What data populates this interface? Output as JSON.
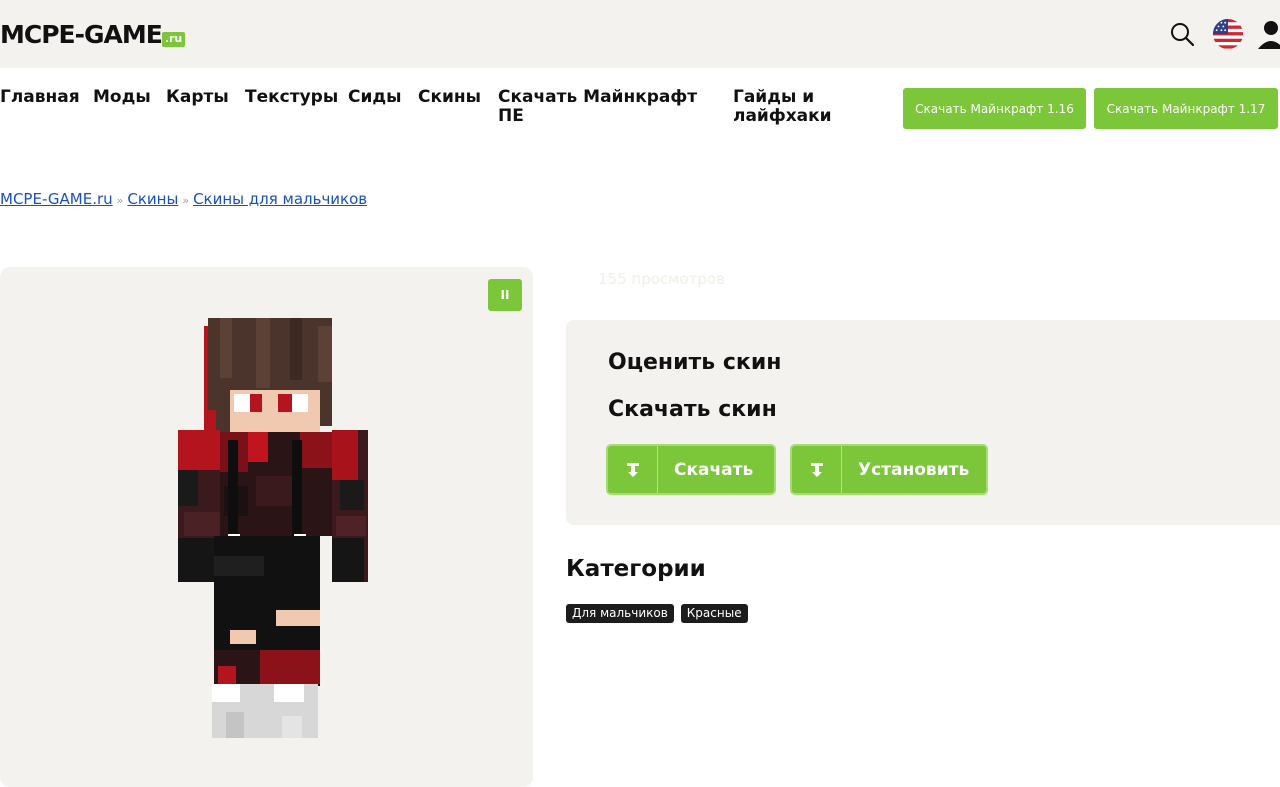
{
  "header": {
    "logo_text": "MCPE-GAME",
    "logo_suffix": ".ru",
    "icons": [
      "search-icon",
      "us-flag-icon",
      "user-icon"
    ]
  },
  "nav": {
    "items": [
      "Главная",
      "Моды",
      "Карты",
      "Текстуры",
      "Сиды",
      "Скины",
      "Скачать Майнкрафт ПЕ",
      "Гайды и лайфхаки"
    ],
    "download_buttons": [
      "Скачать Майнкрафт 1.16",
      "Скачать Майнкрафт 1.17"
    ]
  },
  "breadcrumb": {
    "items": [
      "MCPE-GAME.ru",
      "Скины",
      "Скины для мальчиков"
    ],
    "separator": "»"
  },
  "skin": {
    "pause_label": "II",
    "views": "155 просмотров"
  },
  "actions": {
    "rate_title": "Оценить скин",
    "download_title": "Скачать скин",
    "download_label": "Скачать",
    "install_label": "Установить"
  },
  "categories": {
    "title": "Категории",
    "tags": [
      "Для мальчиков",
      "Красные"
    ]
  },
  "colors": {
    "accent": "#7cc63a",
    "panel": "#f4f2ee",
    "link": "#1a4fc8"
  }
}
